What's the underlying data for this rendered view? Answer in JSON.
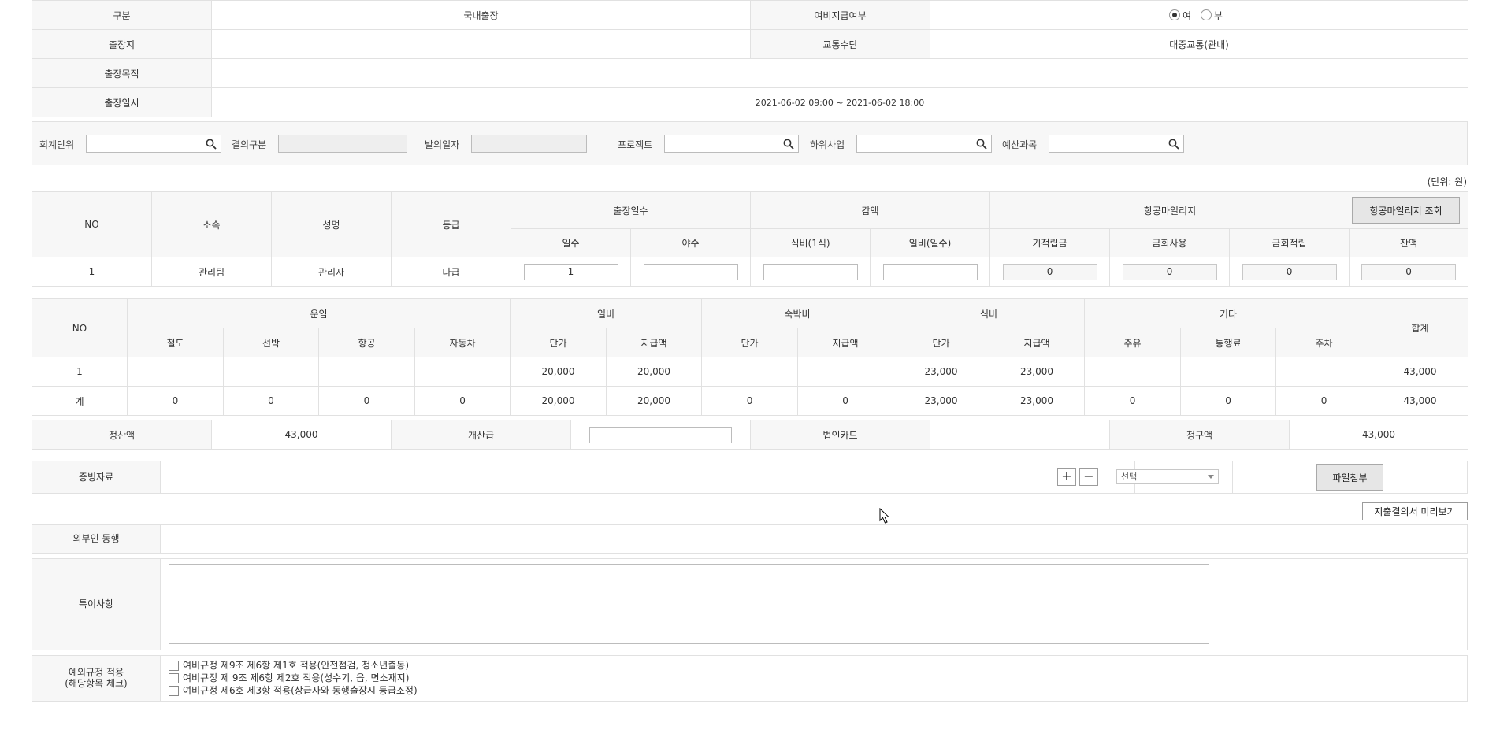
{
  "trip": {
    "type_label": "구분",
    "type_value": "국내출장",
    "expense_label": "여비지급여부",
    "radio_yes": "여",
    "radio_no": "부",
    "place_label": "출장지",
    "place_value": "",
    "transport_label": "교통수단",
    "transport_value": "대중교통(관내)",
    "purpose_label": "출장목적",
    "purpose_value": "",
    "datetime_label": "출장일시",
    "datetime_value": "2021-06-02 09:00 ~ 2021-06-02 18:00"
  },
  "filter": {
    "acct_unit_label": "회계단위",
    "approval_type_label": "결의구분",
    "draft_date_label": "발의일자",
    "project_label": "프로젝트",
    "sub_business_label": "하위사업",
    "budget_label": "예산과목"
  },
  "unit_note": "(단위: 원)",
  "traveler": {
    "headers": {
      "no": "NO",
      "dept": "소속",
      "name": "성명",
      "grade": "등급",
      "days_group": "출장일수",
      "days": "일수",
      "nights": "야수",
      "deduct_group": "감액",
      "meal_deduct": "식비(1식)",
      "daily_deduct": "일비(일수)",
      "mileage_group": "항공마일리지",
      "mileage_btn": "항공마일리지 조회",
      "accumulated": "기적립금",
      "this_use": "금회사용",
      "this_accum": "금회적립",
      "balance": "잔액"
    },
    "row": {
      "no": "1",
      "dept": "관리팀",
      "name": "관리자",
      "grade": "나급",
      "days": "1",
      "nights": "",
      "meal_deduct": "",
      "daily_deduct": "",
      "accumulated": "0",
      "this_use": "0",
      "this_accum": "0",
      "balance": "0"
    }
  },
  "cost": {
    "headers": {
      "no": "NO",
      "fare_group": "운임",
      "rail": "철도",
      "ship": "선박",
      "air": "항공",
      "car": "자동차",
      "daily_group": "일비",
      "lodging_group": "숙박비",
      "meal_group": "식비",
      "etc_group": "기타",
      "unit_price": "단가",
      "paid": "지급액",
      "fuel": "주유",
      "toll": "통행료",
      "parking": "주차",
      "total": "합계"
    },
    "rows": [
      [
        "1",
        "",
        "",
        "",
        "",
        "20,000",
        "20,000",
        "",
        "",
        "23,000",
        "23,000",
        "",
        "",
        "",
        "43,000"
      ],
      [
        "계",
        "0",
        "0",
        "0",
        "0",
        "20,000",
        "20,000",
        "0",
        "0",
        "23,000",
        "23,000",
        "0",
        "0",
        "0",
        "43,000"
      ]
    ]
  },
  "settle": {
    "settle_label": "정산액",
    "settle_value": "43,000",
    "prepay_label": "개산급",
    "card_label": "법인카드",
    "card_value": "",
    "claim_label": "청구액",
    "claim_value": "43,000"
  },
  "evidence": {
    "label": "증빙자료",
    "select_value": "선택",
    "attach_btn": "파일첨부"
  },
  "preview_btn": "지출결의서 미리보기",
  "companion": {
    "label": "외부인 동행",
    "value": ""
  },
  "remarks": {
    "label": "특이사항",
    "value": ""
  },
  "exception": {
    "label_line1": "예외규정 적용",
    "label_line2": "(해당항목 체크)",
    "items": [
      "여비규정 제9조 제6항 제1호 적용(안전점검, 청소년출동)",
      "여비규정 제 9조 제6항 제2호 적용(성수기, 읍, 면소재지)",
      "여비규정 제6호 제3항 적용(상급자와 동행출장시 등급조정)"
    ]
  },
  "colors": {
    "header_bg": "#f7f7f7",
    "border": "#e1e1e1",
    "radio_selected": "#333333"
  }
}
